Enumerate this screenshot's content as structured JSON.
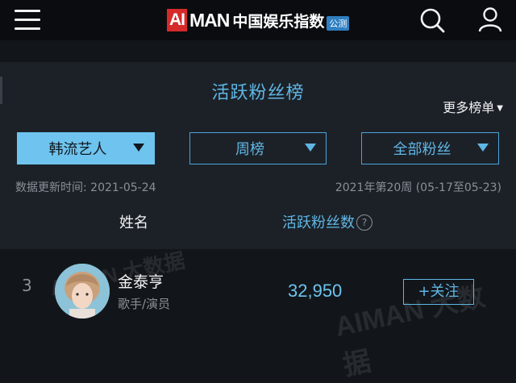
{
  "header": {
    "logo_ai": "AI",
    "logo_man": "MAN",
    "logo_cn": "中国娱乐指数",
    "logo_badge": "公测",
    "icons": [
      "menu-icon",
      "search-icon",
      "user-icon"
    ]
  },
  "section": {
    "title": "活跃粉丝榜",
    "more_label": "更多榜单"
  },
  "filters": {
    "category": "韩流艺人",
    "period": "周榜",
    "fan_type": "全部粉丝"
  },
  "meta": {
    "update_time": "数据更新时间: 2021-05-24",
    "week_range": "2021年第20周 (05-17至05-23)"
  },
  "table": {
    "headers": {
      "name": "姓名",
      "fans": "活跃粉丝数",
      "help_glyph": "?"
    },
    "rows": [
      {
        "rank": "3",
        "name": "金泰亨",
        "role": "歌手/演员",
        "fans": "32,950",
        "action": "+关注"
      }
    ]
  },
  "watermark": "AIMAN 大数据",
  "colors": {
    "accent": "#5fb6e4",
    "logo_red": "#d62a2a",
    "background": "#12161b",
    "panel": "#1c2128"
  }
}
